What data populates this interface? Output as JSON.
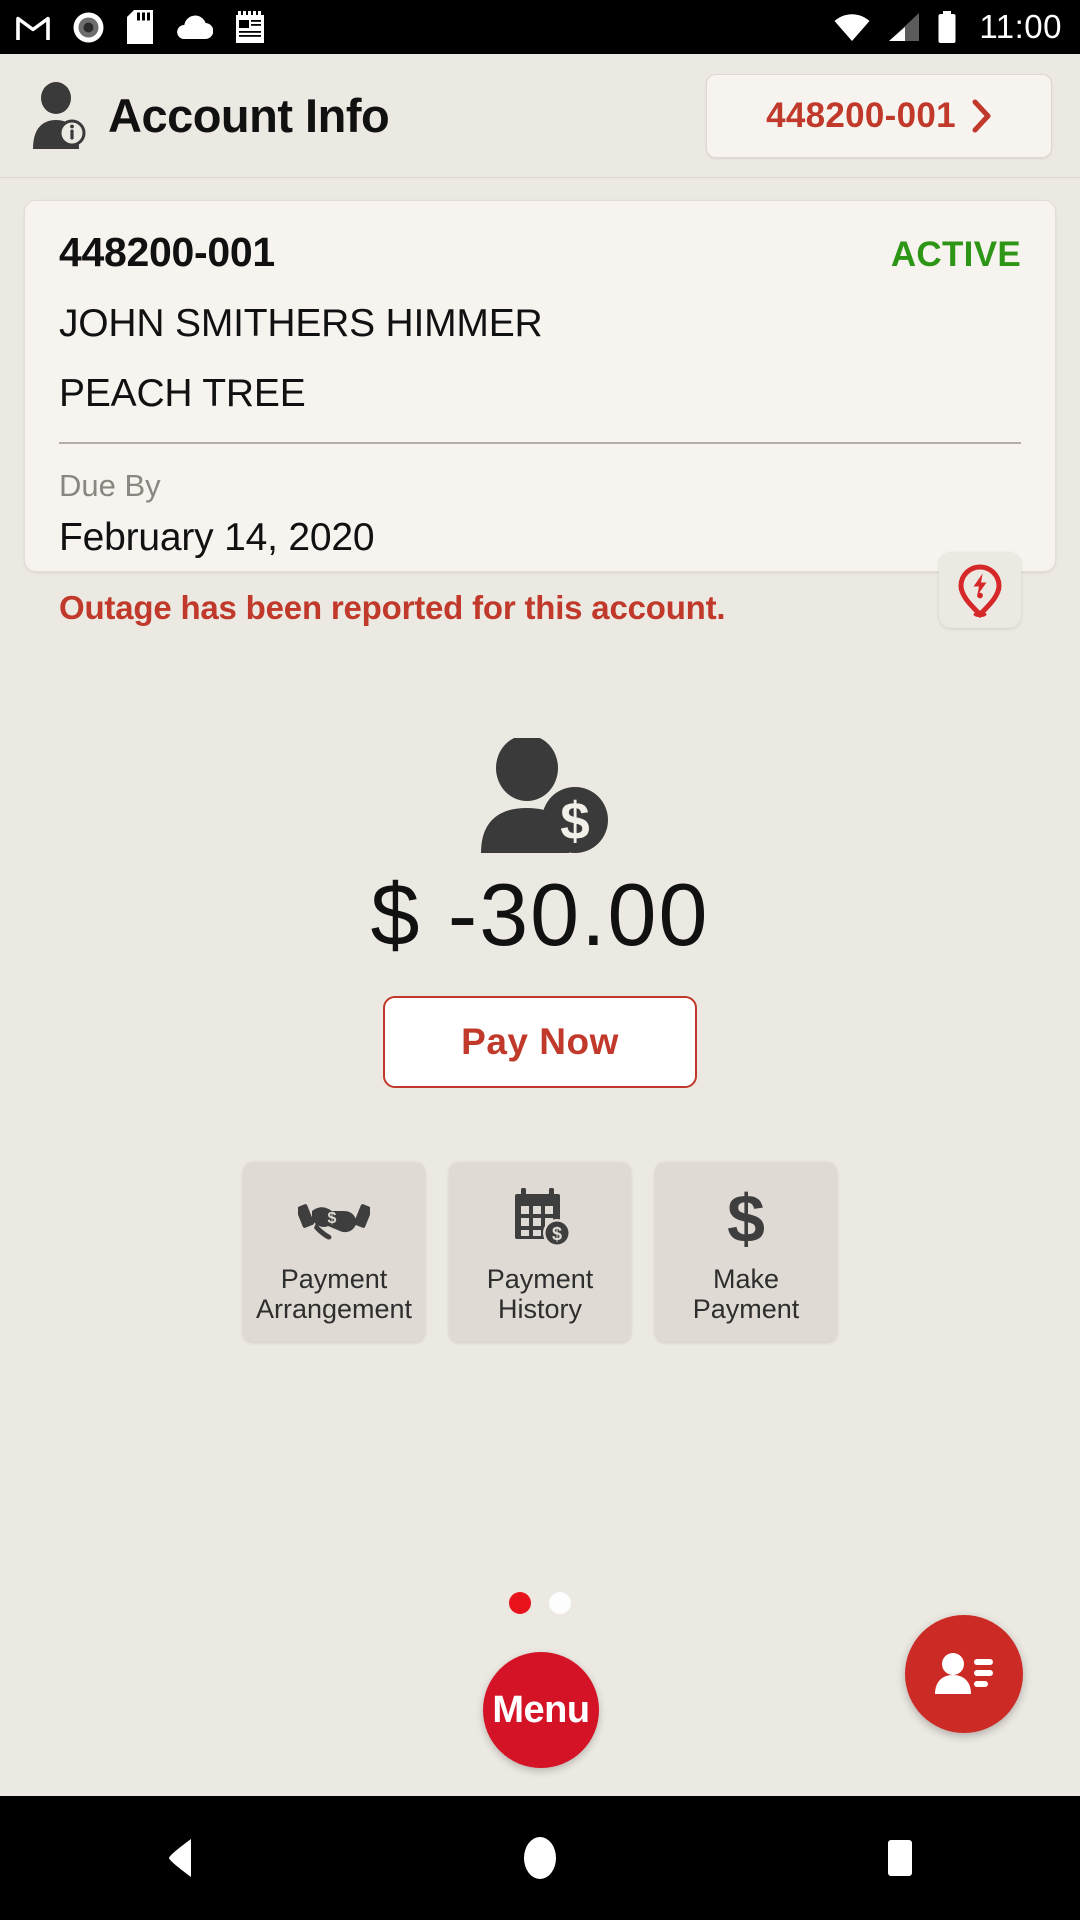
{
  "status_bar": {
    "time": "11:00",
    "left_icons": [
      "gmail-icon",
      "record-icon",
      "sd-card-icon",
      "cloud-icon",
      "news-icon"
    ],
    "right_icons": [
      "wifi-icon",
      "cellular-signal-icon",
      "battery-icon"
    ]
  },
  "header": {
    "title": "Account Info",
    "icon": "account-info-icon",
    "account_selector": {
      "label": "448200-001",
      "chevron": "chevron-right-icon"
    }
  },
  "account_card": {
    "account_number": "448200-001",
    "status": "ACTIVE",
    "status_color": "#2e9616",
    "customer_name": "JOHN SMITHERS HIMMER",
    "address": "PEACH TREE",
    "due_by_label": "Due By",
    "due_date": "February 14, 2020",
    "outage_message": "Outage has been reported for this account.",
    "outage_color": "#c0392b",
    "outage_icon": "outage-pin-icon"
  },
  "balance": {
    "icon": "customer-balance-icon",
    "currency": "$",
    "amount": "-30.00",
    "display": "$ -30.00",
    "pay_now_label": "Pay Now",
    "accent_color": "#c0392b"
  },
  "tiles": [
    {
      "label_line1": "Payment",
      "label_line2": "Arrangement",
      "icon": "handshake-dollar-icon"
    },
    {
      "label_line1": "Payment",
      "label_line2": "History",
      "icon": "calendar-dollar-icon"
    },
    {
      "label_line1": "Make",
      "label_line2": "Payment",
      "icon": "dollar-sign-icon"
    }
  ],
  "pager": {
    "total": 2,
    "active_index": 0,
    "active_color": "#e8131d",
    "inactive_color": "#fdfdfd"
  },
  "menu_button": {
    "label": "Menu",
    "color": "#d41326"
  },
  "contacts_button": {
    "icon": "contacts-icon",
    "color": "#cc2a25"
  },
  "nav_bar": {
    "back": "back-triangle-icon",
    "home": "home-circle-icon",
    "recents": "recents-square-icon"
  }
}
